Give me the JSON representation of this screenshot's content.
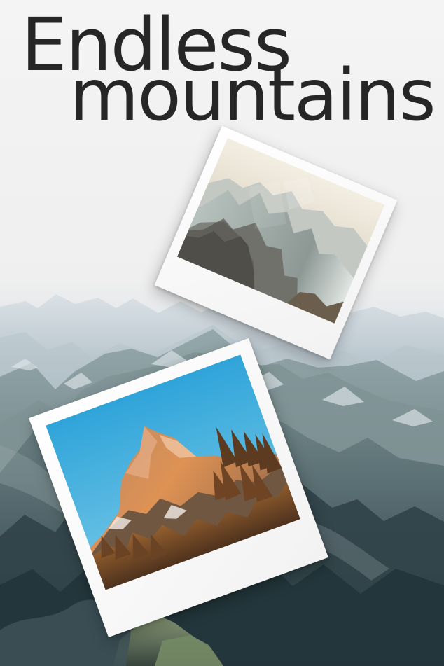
{
  "title": {
    "line1": "Endless",
    "line2": "mountains"
  },
  "colors": {
    "text": "#262626",
    "sky": "#f0f0f0",
    "mountain_dark": "#41535a",
    "mountain_mid": "#73868b",
    "snow": "#d9e1e6",
    "orange_peak": "#d47e45",
    "blue_sky_photo": "#3eaee0"
  },
  "images": {
    "background": "misty mountain range",
    "top_photo": "hazy mountain ridges in warm light",
    "bottom_photo": "orange lit mountain peak under blue sky"
  }
}
